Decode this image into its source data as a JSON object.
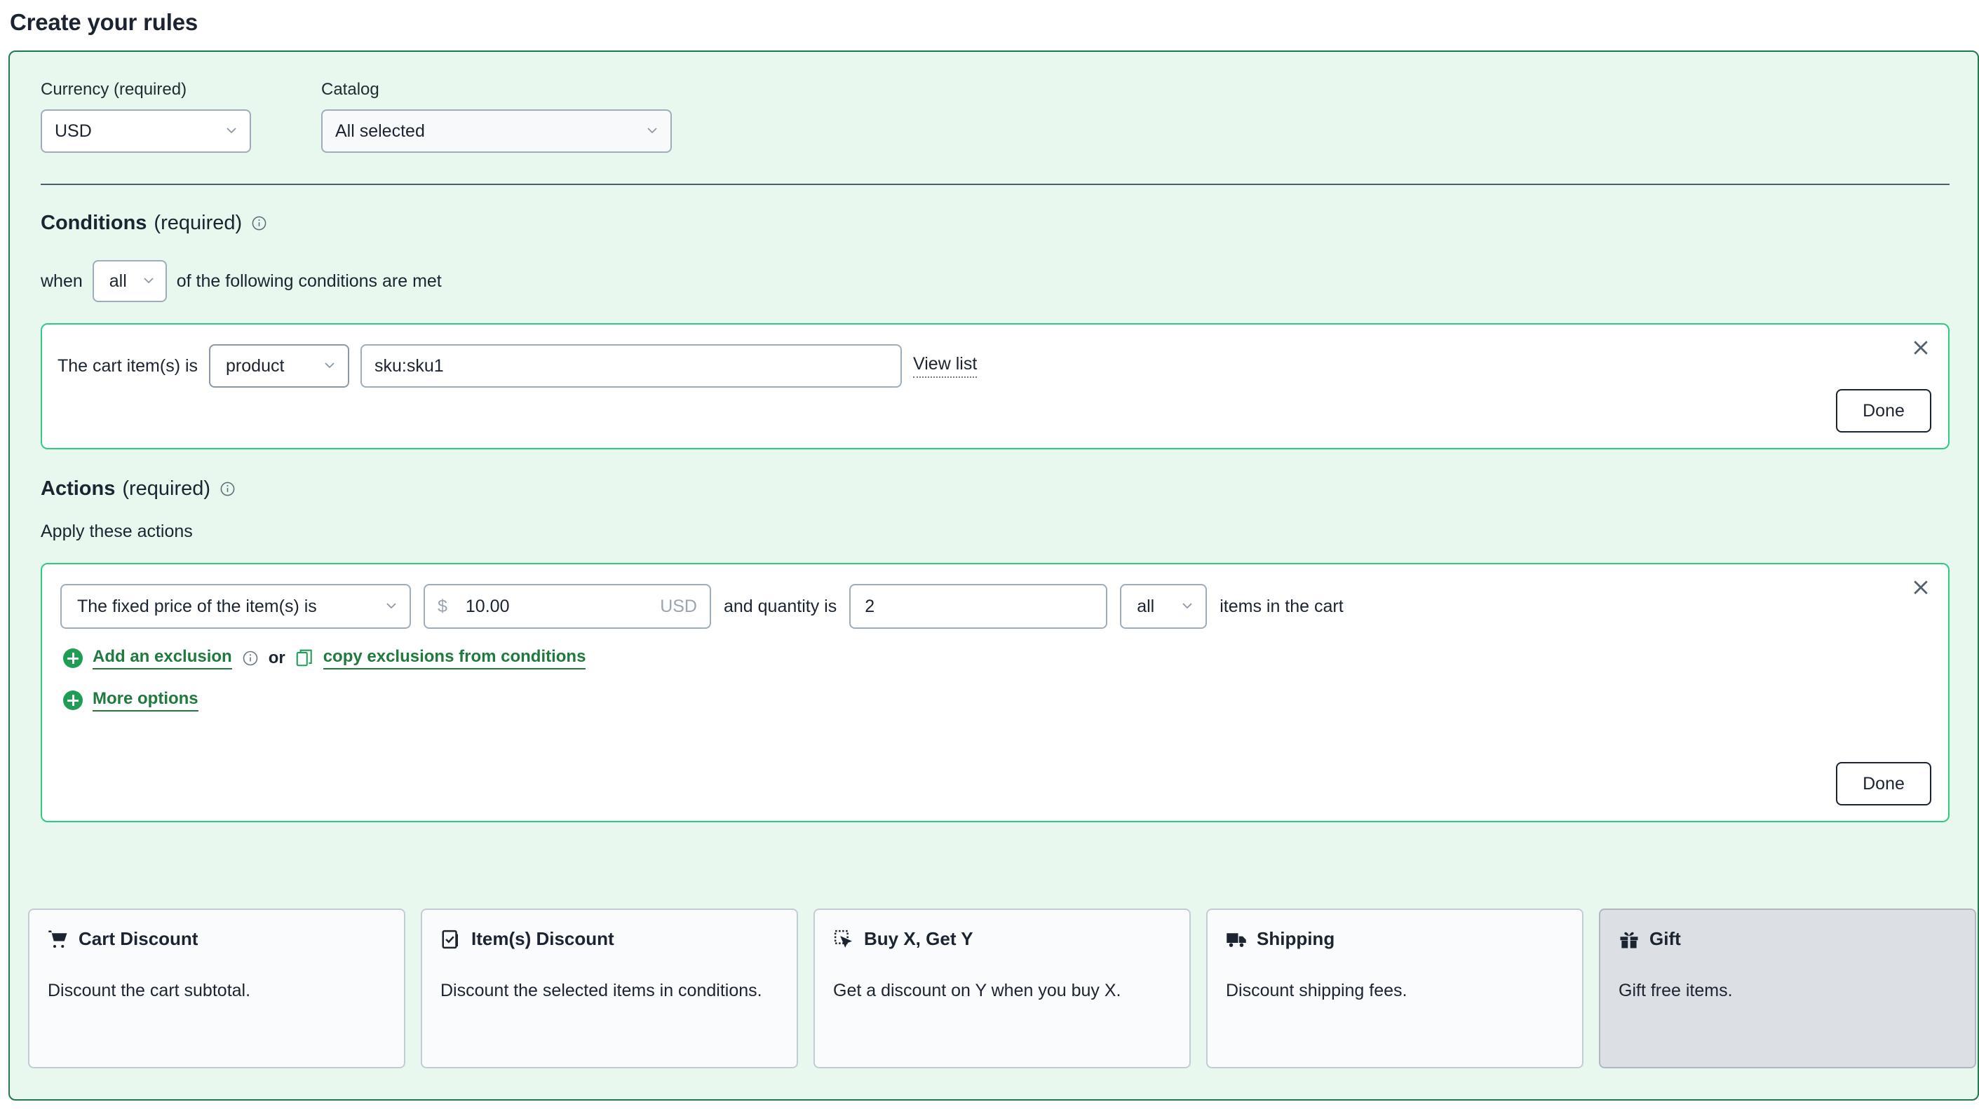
{
  "page": {
    "title": "Create your rules"
  },
  "top": {
    "currency": {
      "label": "Currency (required)",
      "value": "USD"
    },
    "catalog": {
      "label": "Catalog",
      "value": "All selected"
    }
  },
  "conditions": {
    "heading_strong": "Conditions",
    "heading_required": "(required)",
    "when_prefix": "when",
    "match_value": "all",
    "when_suffix": "of the following conditions are met",
    "rule": {
      "prefix": "The cart item(s) is",
      "type_value": "product",
      "input_value": "sku:sku1",
      "view_list": "View list",
      "done": "Done"
    }
  },
  "actions": {
    "heading_strong": "Actions",
    "heading_required": "(required)",
    "apply_label": "Apply these actions",
    "rule": {
      "action_value": "The fixed price of the item(s) is",
      "currency_symbol": "$",
      "amount": "10.00",
      "currency_code": "USD",
      "quantity_prefix": "and quantity is",
      "quantity": "2",
      "quantity_scope": "all",
      "quantity_suffix": "items in the cart",
      "add_exclusion": "Add an exclusion",
      "or": "or",
      "copy_exclusions": "copy exclusions from conditions",
      "more_options": "More options",
      "done": "Done"
    }
  },
  "option_cards": [
    {
      "title": "Cart Discount",
      "desc": "Discount the cart subtotal.",
      "icon": "cart-icon",
      "selected": false
    },
    {
      "title": "Item(s) Discount",
      "desc": "Discount the selected items in conditions.",
      "icon": "checkbox-doc-icon",
      "selected": false
    },
    {
      "title": "Buy X, Get Y",
      "desc": "Get a discount on Y when you buy X.",
      "icon": "click-icon",
      "selected": false
    },
    {
      "title": "Shipping",
      "desc": "Discount shipping fees.",
      "icon": "truck-icon",
      "selected": false
    },
    {
      "title": "Gift",
      "desc": "Gift free items.",
      "icon": "gift-icon",
      "selected": true
    }
  ],
  "colors": {
    "panel_bg": "#e8f8ef",
    "panel_border": "#1f7a4d",
    "card_border_green": "#2ecc80",
    "link_green": "#1f7a3d",
    "accent_green": "#1f9d55"
  }
}
